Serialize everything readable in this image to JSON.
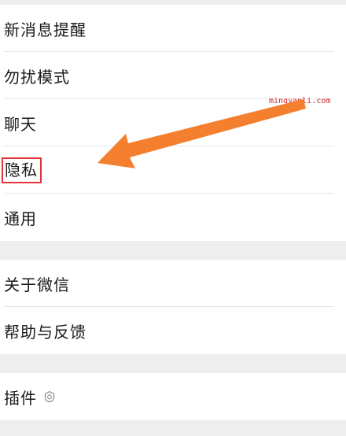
{
  "settings": {
    "group1": [
      {
        "label": "新消息提醒"
      },
      {
        "label": "勿扰模式"
      },
      {
        "label": "聊天"
      },
      {
        "label": "隐私"
      },
      {
        "label": "通用"
      }
    ],
    "group2": [
      {
        "label": "关于微信"
      },
      {
        "label": "帮助与反馈"
      }
    ],
    "group3": [
      {
        "label": "插件",
        "icon": "plugin-icon"
      }
    ]
  },
  "annotation": {
    "highlight_color": "#e0343a",
    "arrow_color": "#f47f2e",
    "watermark": "mingyanli.com"
  }
}
